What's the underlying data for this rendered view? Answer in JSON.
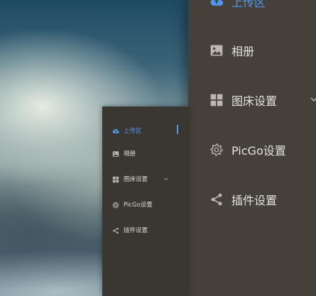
{
  "colors": {
    "panel": "#454039",
    "panel_small": "#3a3631",
    "accent": "#4f98ee",
    "text": "#e6e3dd",
    "icon": "#bcb8b1"
  },
  "sidebar_large": {
    "items": [
      {
        "label": "上传区",
        "icon": "cloud-upload-icon",
        "active": true
      },
      {
        "label": "相册",
        "icon": "image-icon"
      },
      {
        "label": "图床设置",
        "icon": "grid-icon",
        "has_submenu": true
      },
      {
        "label": "PicGo设置",
        "icon": "gear-icon"
      },
      {
        "label": "插件设置",
        "icon": "share-icon"
      }
    ]
  },
  "sidebar_small": {
    "items": [
      {
        "label": "上传区",
        "icon": "cloud-upload-icon",
        "active": true
      },
      {
        "label": "相册",
        "icon": "image-icon"
      },
      {
        "label": "图床设置",
        "icon": "grid-icon",
        "has_submenu": true
      },
      {
        "label": "PicGo设置",
        "icon": "gear-icon"
      },
      {
        "label": "插件设置",
        "icon": "share-icon"
      }
    ]
  }
}
